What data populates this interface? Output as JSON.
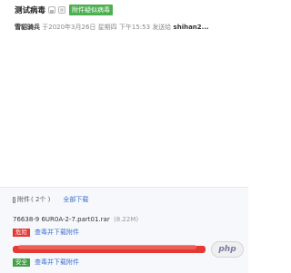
{
  "mail": {
    "subject": "测试病毒",
    "virus_badge": "附件疑似病毒",
    "sender": "雪貂骑兵",
    "sent_prefix": "于",
    "date": "2020年3月26日",
    "weekday": "星期四",
    "time": "下午15:53",
    "sent_to_label": "发送给",
    "recipient": "shihan2..."
  },
  "attachments": {
    "label": "附件",
    "count_text": "( 2个 )",
    "download_all": "全部下载",
    "files": [
      {
        "name": "76638-9 6UR0A-2-7.part01.rar",
        "size": "(8.22M)",
        "status": "危险",
        "action": "查毒并下载附件"
      },
      {
        "status": "安全",
        "action": "查毒并下载附件"
      }
    ]
  },
  "watermark": "php",
  "colors": {
    "danger": "#e53935",
    "safe": "#43a047",
    "virus_badge": "#4caf50",
    "link": "#3b6fd1"
  },
  "icons": [
    "lock-icon",
    "share-icon",
    "paperclip-icon"
  ]
}
